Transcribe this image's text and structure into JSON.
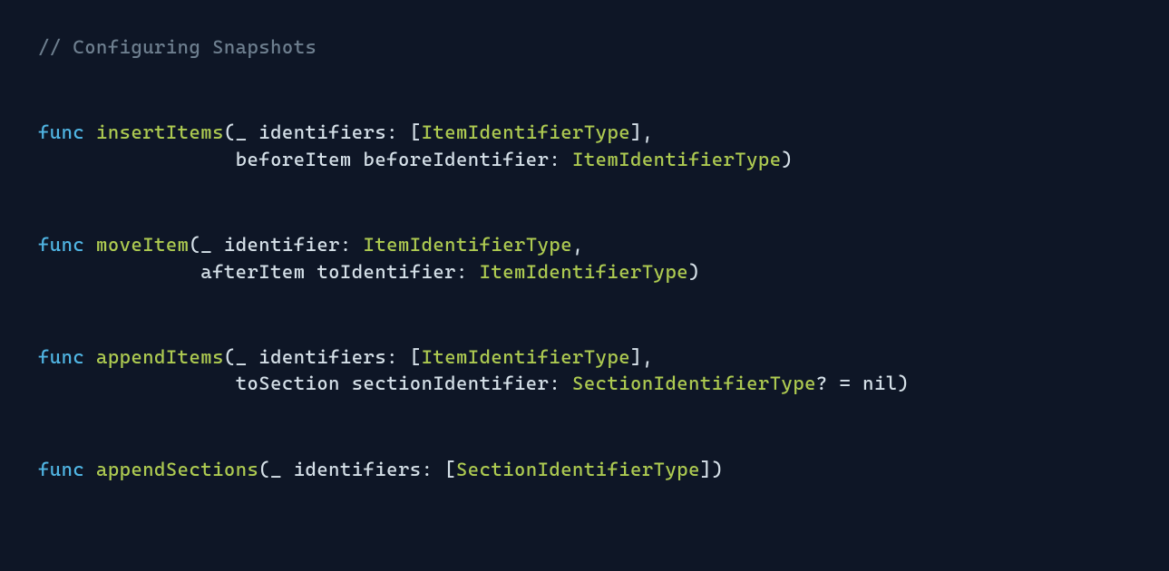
{
  "comment": "// Configuring Snapshots",
  "functions": [
    {
      "keyword": "func",
      "name": "insertItems",
      "line1_prefix": "(_ identifiers: [",
      "line1_type": "ItemIdentifierType",
      "line1_suffix": "],",
      "line2_indent": "                 ",
      "line2_prefix": "beforeItem beforeIdentifier: ",
      "line2_type": "ItemIdentifierType",
      "line2_suffix": ")"
    },
    {
      "keyword": "func",
      "name": "moveItem",
      "line1_prefix": "(_ identifier: ",
      "line1_type": "ItemIdentifierType",
      "line1_suffix": ",",
      "line2_indent": "              ",
      "line2_prefix": "afterItem toIdentifier: ",
      "line2_type": "ItemIdentifierType",
      "line2_suffix": ")"
    },
    {
      "keyword": "func",
      "name": "appendItems",
      "line1_prefix": "(_ identifiers: [",
      "line1_type": "ItemIdentifierType",
      "line1_suffix": "],",
      "line2_indent": "                 ",
      "line2_prefix": "toSection sectionIdentifier: ",
      "line2_type": "SectionIdentifierType",
      "line2_suffix": "? = nil)"
    },
    {
      "keyword": "func",
      "name": "appendSections",
      "line1_prefix": "(_ identifiers: [",
      "line1_type": "SectionIdentifierType",
      "line1_suffix": "])"
    }
  ]
}
